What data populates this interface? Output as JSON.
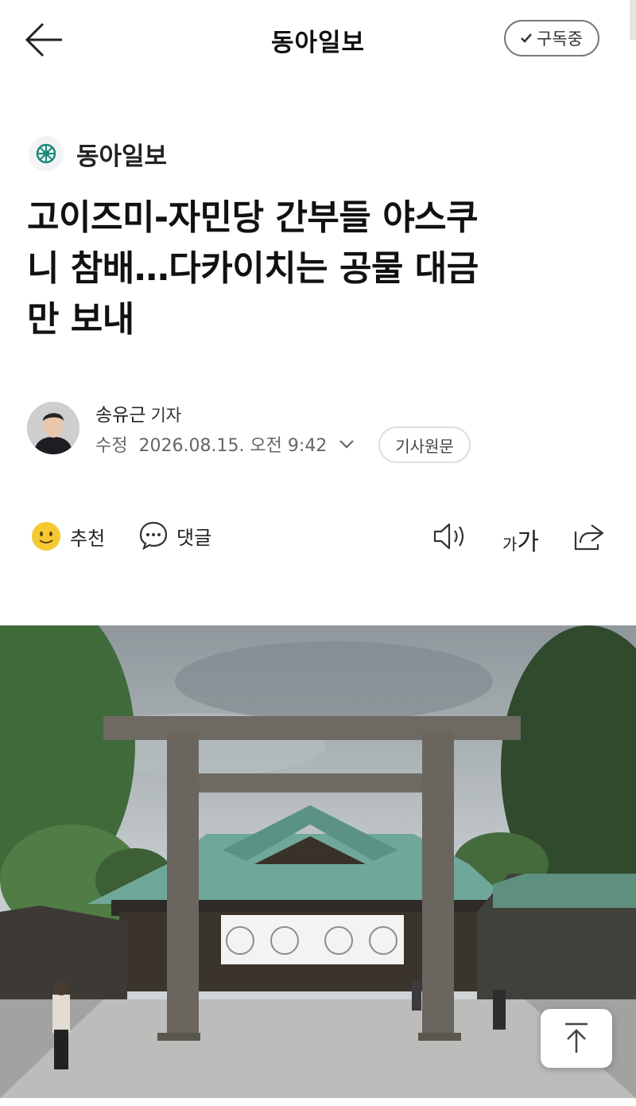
{
  "header": {
    "title": "동아일보",
    "subscribe_label": "구독중"
  },
  "press": {
    "name": "동아일보"
  },
  "article": {
    "headline_lines": [
      "고이즈미-자민당 간부들 야스쿠",
      "니 참배…다카이치는 공물 대금",
      "만 보내"
    ],
    "author": {
      "name": "송유근",
      "role": "기자"
    },
    "meta": {
      "status": "수정",
      "date": "2026.08.15. 오전 9:42"
    },
    "original_label": "기사원문"
  },
  "actions": {
    "recommend_label": "추천",
    "comment_label": "댓글",
    "font_size_small": "가",
    "font_size_large": "가"
  },
  "colors": {
    "text": "#111111",
    "roof_green": "#6fa89a",
    "torii_gray": "#6e6a63",
    "emoji_yellow": "#f5c930"
  }
}
